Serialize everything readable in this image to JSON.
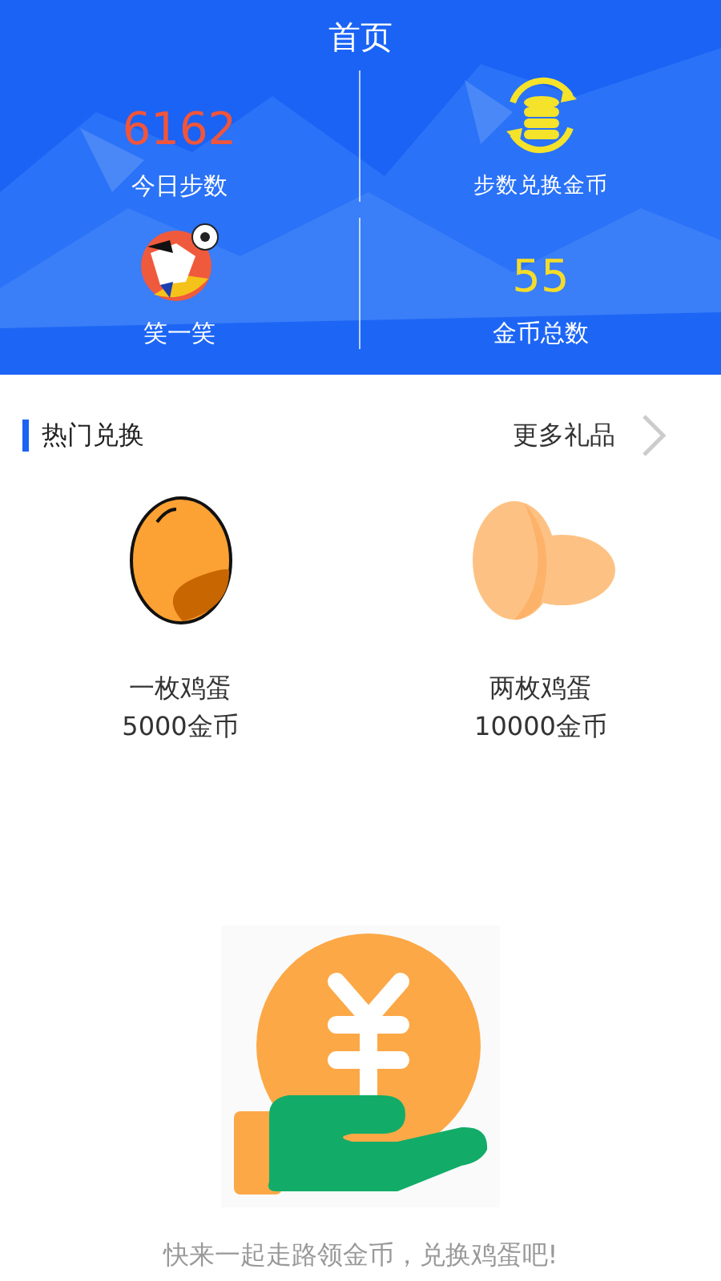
{
  "header": {
    "title": "首页"
  },
  "stats": [
    {
      "kind": "number",
      "value": "6162",
      "color": "#f0553c",
      "label": "今日步数"
    },
    {
      "kind": "coins",
      "label": "步数兑换金币"
    },
    {
      "kind": "mascot",
      "label": "笑一笑"
    },
    {
      "kind": "number",
      "value": "55",
      "color": "#f5dc2a",
      "label": "金币总数"
    }
  ],
  "section": {
    "title": "热门兑换",
    "more": "更多礼品"
  },
  "gifts": [
    {
      "kind": "one-egg",
      "name": "一枚鸡蛋",
      "price": "5000金币"
    },
    {
      "kind": "two-eggs",
      "name": "两枚鸡蛋",
      "price": "10000金币"
    }
  ],
  "caption": "快来一起走路领金币，兑换鸡蛋吧!"
}
